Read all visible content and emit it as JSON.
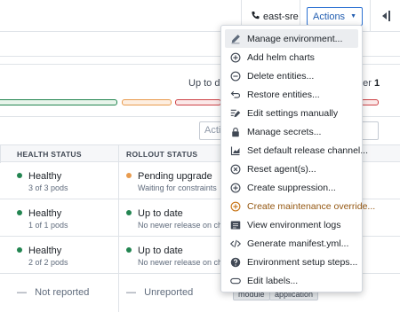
{
  "header": {
    "environment": "east-sre",
    "actions_label": "Actions"
  },
  "summary": {
    "up_to_date_label": "Up to dat",
    "no_newer_release_label": "ner",
    "no_newer_release_count": "1"
  },
  "filter": {
    "placeholder": "Actio"
  },
  "table": {
    "headers": [
      "HEALTH STATUS",
      "ROLLOUT STATUS"
    ],
    "rows": [
      {
        "health": "Healthy",
        "health_detail": "3 of 3 pods",
        "rollout": "Pending upgrade",
        "rollout_detail": "Waiting for constraints"
      },
      {
        "health": "Healthy",
        "health_detail": "1 of 1 pods",
        "rollout": "Up to date",
        "rollout_detail": "No newer release on channe"
      },
      {
        "health": "Healthy",
        "health_detail": "2 of 2 pods",
        "rollout": "Up to date",
        "rollout_detail": "No newer release on channe"
      },
      {
        "health": "Not reported",
        "health_detail": "",
        "rollout": "Unreported",
        "rollout_detail": ""
      }
    ],
    "tags": [
      "module",
      "application"
    ]
  },
  "menu": {
    "items": [
      {
        "label": "Manage environment...",
        "icon": "pencil-icon"
      },
      {
        "label": "Add helm charts",
        "icon": "add-circle-icon"
      },
      {
        "label": "Delete entities...",
        "icon": "remove-circle-icon"
      },
      {
        "label": "Restore entities...",
        "icon": "restore-icon"
      },
      {
        "label": "Edit settings manually",
        "icon": "edit-settings-icon"
      },
      {
        "label": "Manage secrets...",
        "icon": "lock-icon"
      },
      {
        "label": "Set default release channel...",
        "icon": "channel-icon"
      },
      {
        "label": "Reset agent(s)...",
        "icon": "reset-icon"
      },
      {
        "label": "Create suppression...",
        "icon": "add-circle-icon"
      },
      {
        "label": "Create maintenance override...",
        "icon": "add-circle-icon"
      },
      {
        "label": "View environment logs",
        "icon": "logs-icon"
      },
      {
        "label": "Generate manifest.yml...",
        "icon": "code-icon"
      },
      {
        "label": "Environment setup steps...",
        "icon": "help-icon"
      },
      {
        "label": "Edit labels...",
        "icon": "label-icon"
      }
    ]
  },
  "colors": {
    "accent": "#2d72d2",
    "success": "#238551",
    "warning": "#e89b4e",
    "warning_text": "#935610",
    "danger": "#cd4246"
  }
}
